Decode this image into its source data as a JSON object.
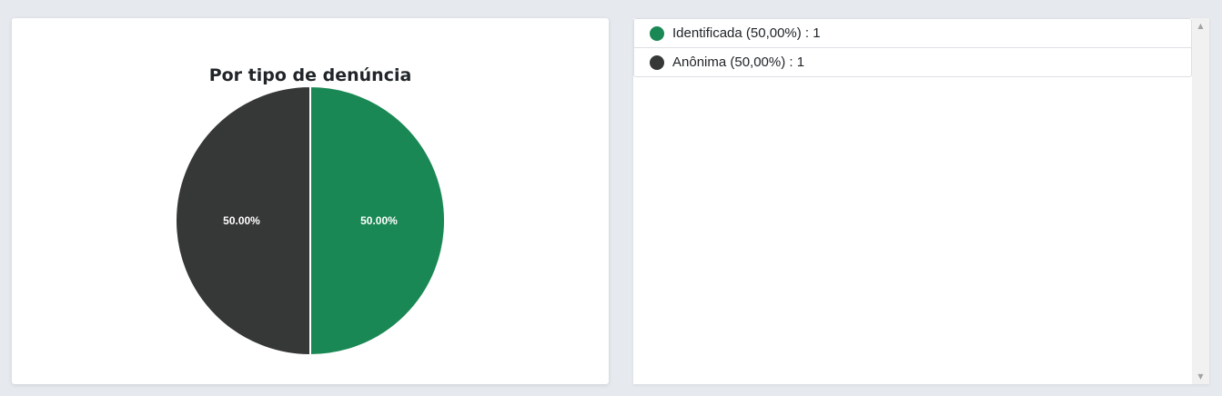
{
  "chart_data": {
    "type": "pie",
    "title": "Por tipo de denúncia",
    "categories": [
      "Identificada",
      "Anônima"
    ],
    "values": [
      1,
      1
    ],
    "percent_labels": [
      "50.00%",
      "50.00%"
    ],
    "colors": [
      "#1a8854",
      "#363737"
    ]
  },
  "legend": {
    "items": [
      {
        "label": "Identificada (50,00%) : 1",
        "color": "#1a8854"
      },
      {
        "label": "Anônima (50,00%) : 1",
        "color": "#363737"
      }
    ]
  },
  "scrollbar": {
    "up_icon": "triangle-up",
    "down_icon": "triangle-down"
  }
}
